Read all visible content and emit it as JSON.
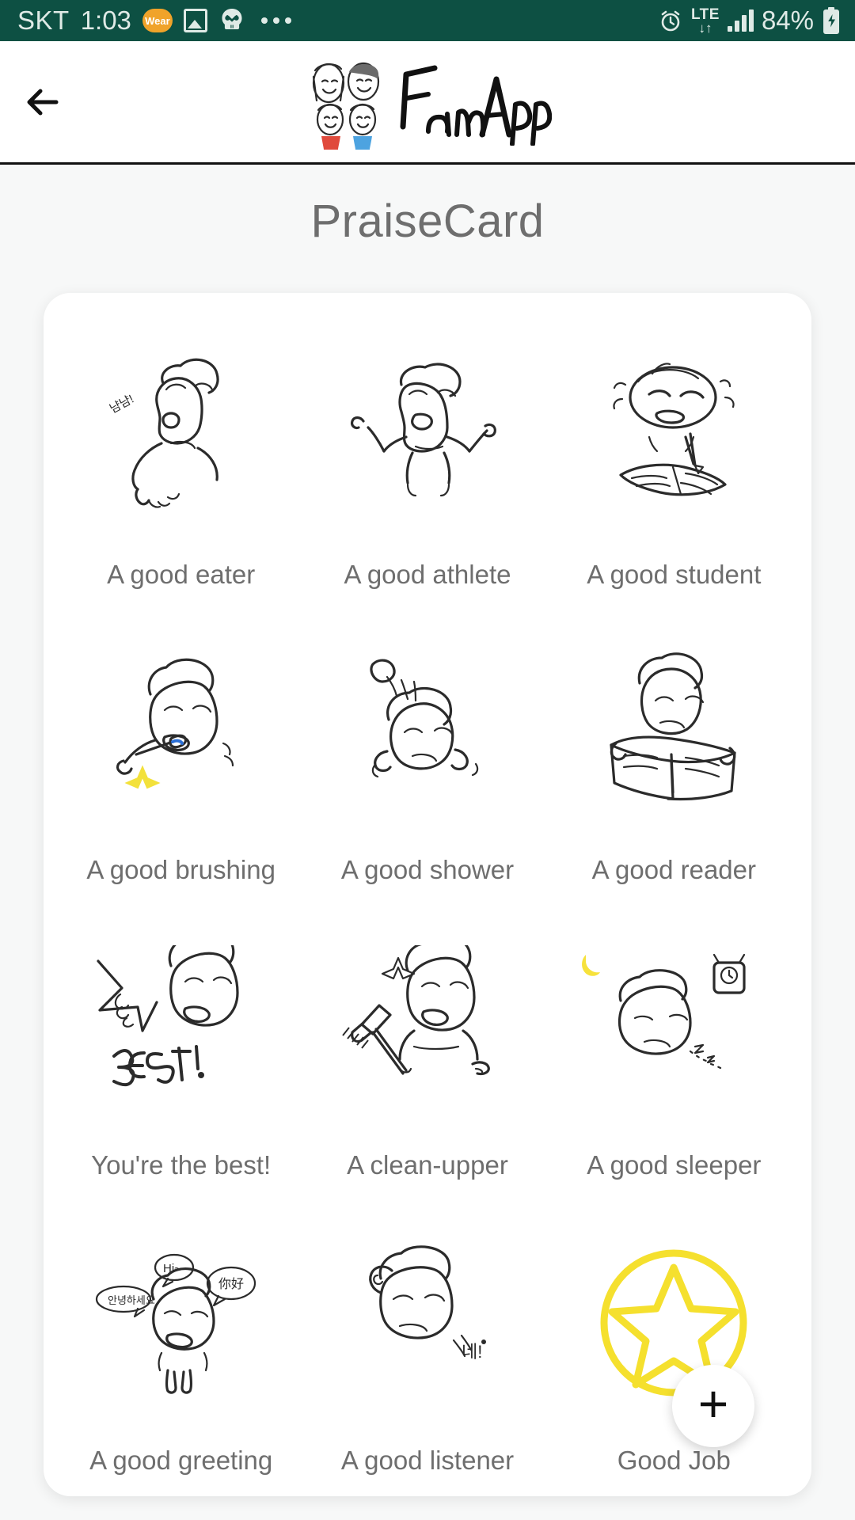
{
  "status_bar": {
    "carrier": "SKT",
    "time": "1:03",
    "wear_badge": "Wear",
    "icons_left": [
      "wear-badge-icon",
      "picture-icon",
      "skull-icon",
      "more-dots-icon"
    ],
    "alarm_icon": "alarm-icon",
    "network_type": "LTE",
    "network_arrows": "↓↑",
    "signal_icon": "signal-bars-icon",
    "battery_percent": "84%",
    "battery_icon": "battery-charging-icon",
    "background_color": "#0d5043",
    "foreground_color": "#dfeae6"
  },
  "header": {
    "back_icon": "back-arrow-icon",
    "brand_name": "FamApp",
    "brand_logo_icon": "family-logo-icon"
  },
  "page": {
    "title": "PraiseCard",
    "background_color": "#f7f8f8",
    "title_color": "#6e6e6e"
  },
  "praise_cards": [
    {
      "label": "A good eater",
      "icon": "child-eating-icon"
    },
    {
      "label": "A good athlete",
      "icon": "child-exercising-icon"
    },
    {
      "label": "A good student",
      "icon": "child-studying-icon"
    },
    {
      "label": "A good brushing",
      "icon": "child-brushing-teeth-icon"
    },
    {
      "label": "A good shower",
      "icon": "child-showering-icon"
    },
    {
      "label": "A good reader",
      "icon": "child-reading-book-icon"
    },
    {
      "label": "You're the best!",
      "icon": "thumbs-up-best-icon"
    },
    {
      "label": "A clean-upper",
      "icon": "child-cleaning-broom-icon"
    },
    {
      "label": "A good sleeper",
      "icon": "child-sleeping-icon"
    },
    {
      "label": "A good greeting",
      "icon": "child-greeting-icon"
    },
    {
      "label": "A good listener",
      "icon": "child-listening-icon"
    },
    {
      "label": "Good Job",
      "icon": "yellow-star-icon"
    }
  ],
  "fab": {
    "label": "+",
    "name": "add-praise-card-button"
  },
  "colors": {
    "star_yellow": "#f5e02e",
    "status_green": "#0d5043",
    "card_white": "#ffffff",
    "text_gray": "#6e6e6e"
  }
}
